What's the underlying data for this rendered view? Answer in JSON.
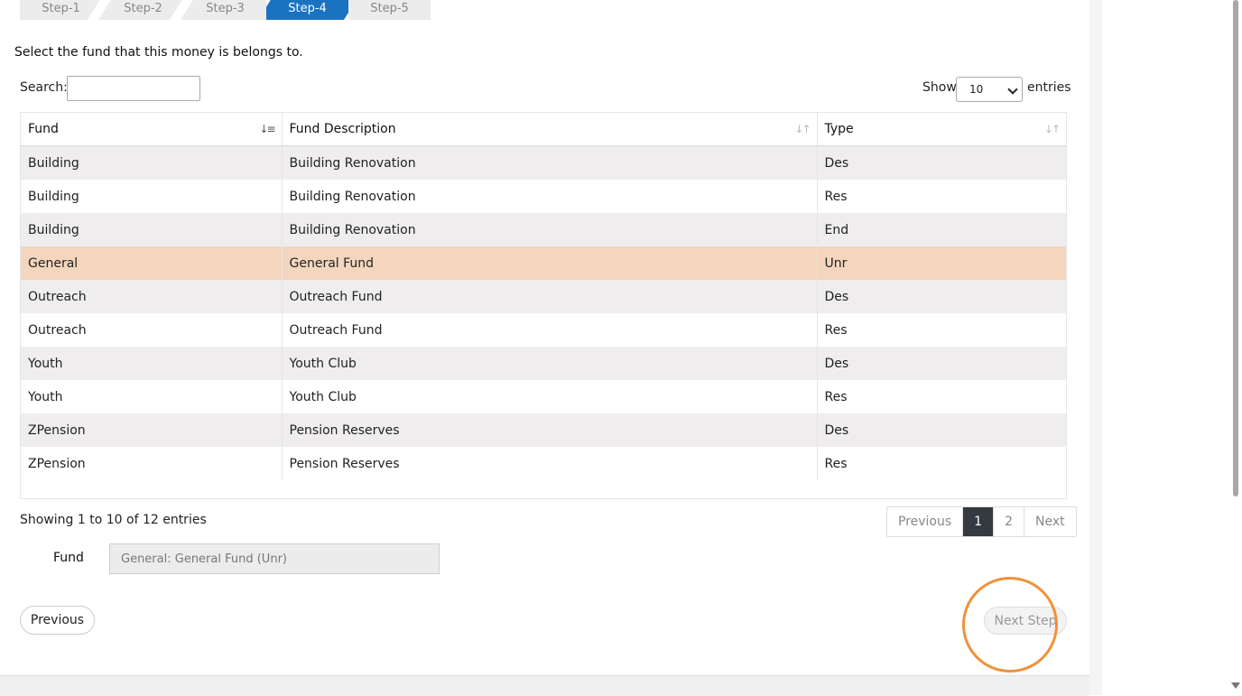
{
  "steps": [
    {
      "label": "Step-1"
    },
    {
      "label": "Step-2"
    },
    {
      "label": "Step-3"
    },
    {
      "label": "Step-4",
      "active": true
    },
    {
      "label": "Step-5"
    }
  ],
  "prompt": "Select the fund that this money is belongs to.",
  "search": {
    "label": "Search:",
    "value": ""
  },
  "length": {
    "show_label": "Show",
    "selected": "10",
    "entries_label": "entries"
  },
  "table": {
    "columns": [
      "Fund",
      "Fund Description",
      "Type"
    ],
    "sorted_column": "Fund",
    "rows": [
      [
        "Building",
        "Building Renovation",
        "Des"
      ],
      [
        "Building",
        "Building Renovation",
        "Res"
      ],
      [
        "Building",
        "Building Renovation",
        "End"
      ],
      [
        "General",
        "General Fund",
        "Unr"
      ],
      [
        "Outreach",
        "Outreach Fund",
        "Des"
      ],
      [
        "Outreach",
        "Outreach Fund",
        "Res"
      ],
      [
        "Youth",
        "Youth Club",
        "Des"
      ],
      [
        "Youth",
        "Youth Club",
        "Res"
      ],
      [
        "ZPension",
        "Pension Reserves",
        "Des"
      ],
      [
        "ZPension",
        "Pension Reserves",
        "Res"
      ]
    ],
    "selected_row": 3
  },
  "info": "Showing 1 to 10 of 12 entries",
  "pagination": {
    "previous": "Previous",
    "pages": [
      "1",
      "2"
    ],
    "current": "1",
    "next": "Next"
  },
  "fund_field": {
    "label": "Fund",
    "value": "General: General Fund (Unr)"
  },
  "buttons": {
    "previous": "Previous",
    "next_step": "Next Step"
  },
  "colors": {
    "active_step": "#1a73c1",
    "selected_row": "#f3d6bd",
    "current_page": "#343a40",
    "highlight_ring": "#f0913a"
  }
}
